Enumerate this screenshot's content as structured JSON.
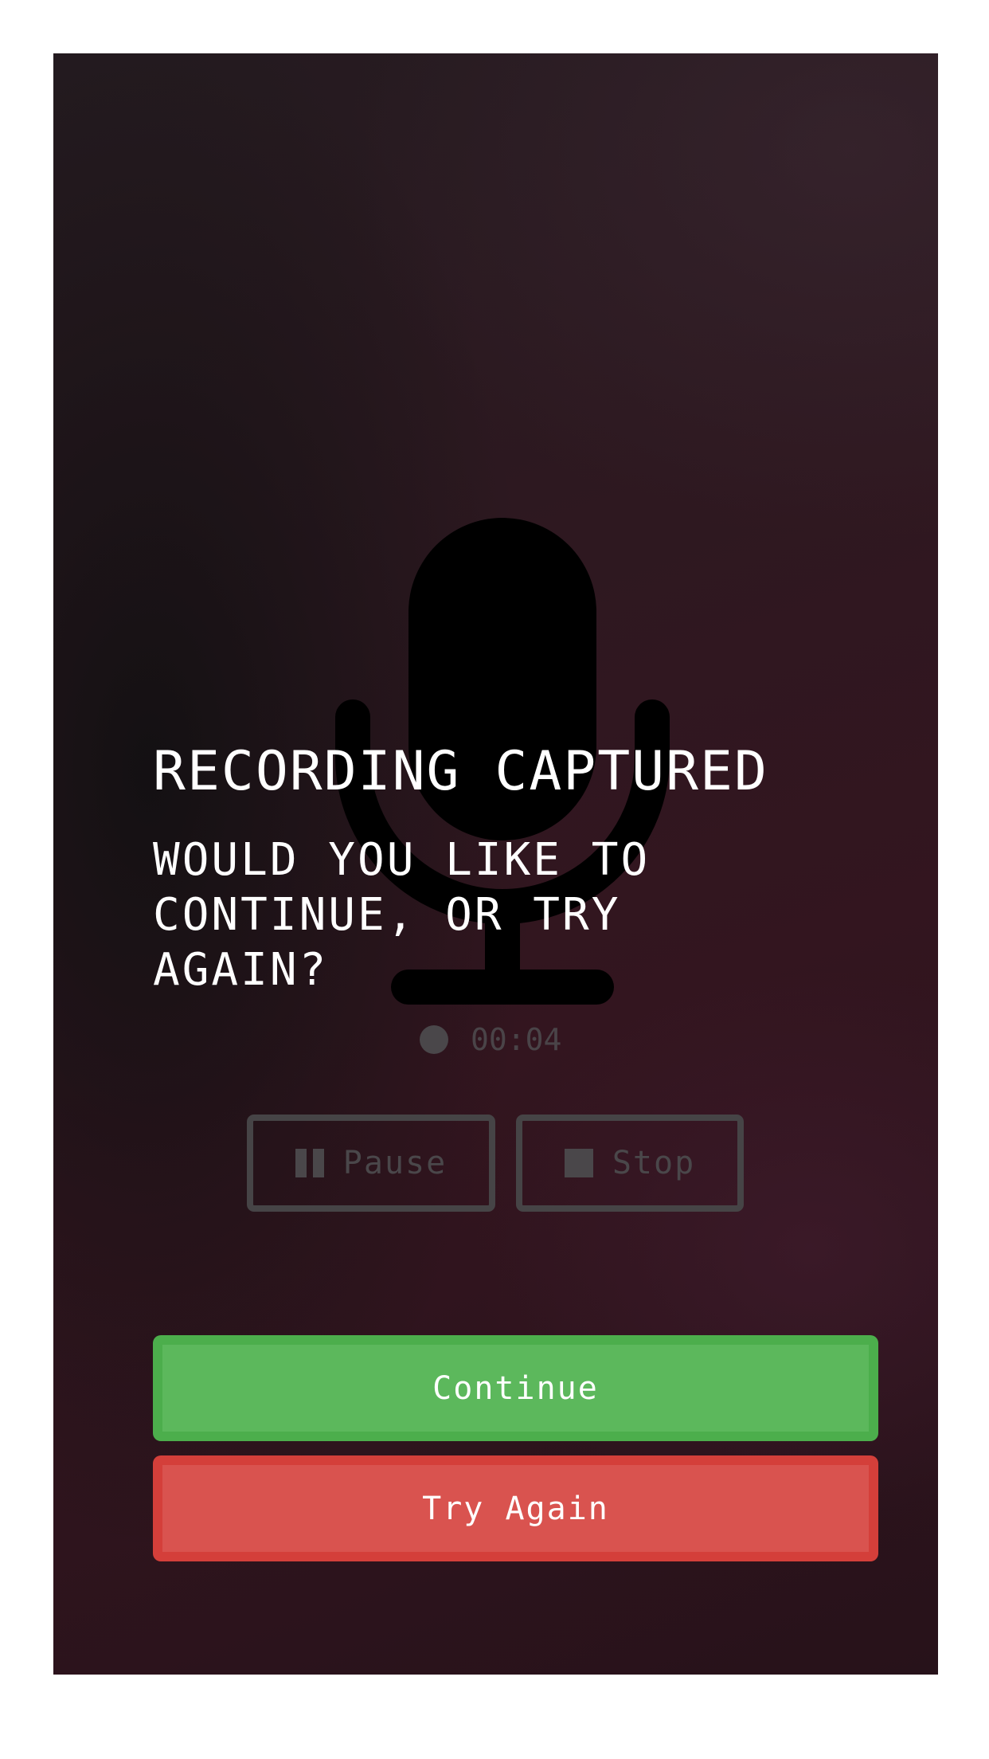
{
  "dialog": {
    "title": "RECORDING CAPTURED",
    "subtitle": "WOULD YOU LIKE TO CONTINUE, OR TRY AGAIN?"
  },
  "recorder": {
    "elapsed": "00:04",
    "pause_label": "Pause",
    "stop_label": "Stop"
  },
  "actions": {
    "continue_label": "Continue",
    "try_again_label": "Try Again"
  },
  "colors": {
    "continue": "#5cb85c",
    "try_again": "#d9534f",
    "disabled_control": "#4a474a"
  },
  "icons": {
    "background": "microphone-icon",
    "recording_indicator": "record-dot-icon",
    "pause": "pause-icon",
    "stop": "stop-icon"
  }
}
